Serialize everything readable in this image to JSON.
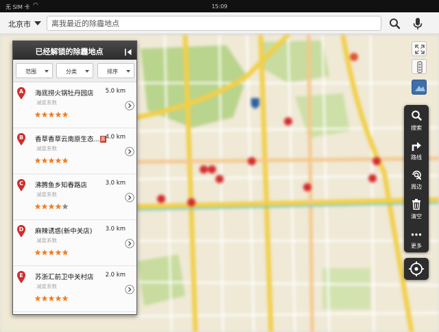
{
  "status": {
    "carrier": "无 SIM 卡",
    "time": "15:09"
  },
  "search": {
    "city": "北京市",
    "placeholder": "离我最近的除霾地点"
  },
  "panel": {
    "title": "已经解锁的除霾地点",
    "filters": [
      {
        "label": "范围"
      },
      {
        "label": "分类"
      },
      {
        "label": "排序"
      }
    ],
    "items": [
      {
        "marker": "A",
        "name": "海底捞火锅牡丹园店",
        "badge": "",
        "distance": "5.0 km",
        "subtitle": "减废系数",
        "rating": 5
      },
      {
        "marker": "B",
        "name": "香草香草云南原生态...",
        "badge": "惠",
        "distance": "4.0 km",
        "subtitle": "减废系数",
        "rating": 5
      },
      {
        "marker": "C",
        "name": "沸腾鱼乡知春路店",
        "badge": "",
        "distance": "3.0 km",
        "subtitle": "减废系数",
        "rating": 4
      },
      {
        "marker": "D",
        "name": "麻辣诱惑(新中关店)",
        "badge": "",
        "distance": "3.0 km",
        "subtitle": "减废系数",
        "rating": 5
      },
      {
        "marker": "E",
        "name": "苏浙汇前卫中关村店",
        "badge": "",
        "distance": "2.0 km",
        "subtitle": "减废系数",
        "rating": 5
      }
    ]
  },
  "toolbar": {
    "items": [
      {
        "label": "搜索",
        "icon": "search-icon"
      },
      {
        "label": "路线",
        "icon": "route-icon"
      },
      {
        "label": "周边",
        "icon": "nearby-icon"
      },
      {
        "label": "清空",
        "icon": "trash-icon"
      },
      {
        "label": "更多",
        "icon": "more-icon"
      }
    ]
  },
  "colors": {
    "marker": "#d42b2b",
    "star": "#f0802a",
    "toolbar": "#2d2d2d",
    "road_main": "#f2cf4a",
    "park": "#b9d48c"
  }
}
